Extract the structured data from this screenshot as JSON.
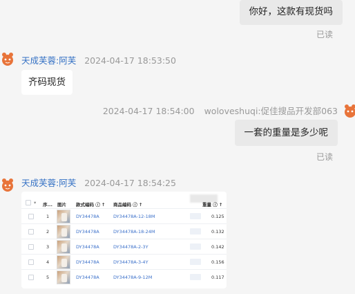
{
  "messages": {
    "m1_text": "你好，这款有现货吗",
    "m1_status": "已读",
    "m2_name": "天成芙蓉:阿芙",
    "m2_time": "2024-04-17 18:53:50",
    "m2_text": "齐码现货",
    "m3_time": "2024-04-17 18:54:00",
    "m3_sender": "woloveshuqi:促佳搜品开发部063",
    "m3_text": "一套的重量是多少呢",
    "m3_status": "已读",
    "m4_name": "天成芙蓉:阿芙",
    "m4_time": "2024-04-17 18:54:25"
  },
  "table": {
    "headers": {
      "seq": "序...",
      "img": "图片",
      "style": "款式编码 ⓘ ↑",
      "product": "商品编码 ⓘ ↑",
      "weight": "重量 ⓘ ↑"
    },
    "rows": [
      {
        "seq": "1",
        "style": "DY34478A",
        "product": "DY34478A-12-18M",
        "weight": "0.125"
      },
      {
        "seq": "2",
        "style": "DY34478A",
        "product": "DY34478A-18-24M",
        "weight": "0.132"
      },
      {
        "seq": "3",
        "style": "DY34478A",
        "product": "DY34478A-2-3Y",
        "weight": "0.142"
      },
      {
        "seq": "4",
        "style": "DY34478A",
        "product": "DY34478A-3-4Y",
        "weight": "0.156"
      },
      {
        "seq": "5",
        "style": "DY34478A",
        "product": "DY34478A-9-12M",
        "weight": "0.117"
      }
    ]
  },
  "icons": {
    "avatar": "crab-avatar-icon",
    "checkbox": "checkbox-icon",
    "thumbnail": "product-thumbnail"
  },
  "colors": {
    "name": "#3370c4",
    "link": "#3a6fc9",
    "bubble_self": "#e9e9e9",
    "bubble_other": "#ffffff",
    "avatar": "#e8743a"
  }
}
